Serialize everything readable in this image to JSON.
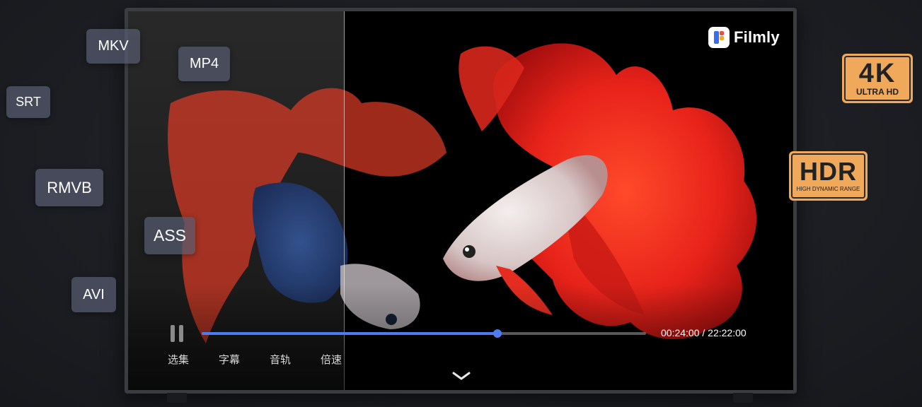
{
  "player": {
    "logo_text": "Filmly",
    "time_display": "00:24:00 / 22:22:00",
    "progress_percent": 66.5,
    "controls": [
      "选集",
      "字幕",
      "音轨",
      "倍速"
    ]
  },
  "format_tags": [
    "MKV",
    "MP4",
    "SRT",
    "RMVB",
    "ASS",
    "AVI"
  ],
  "badges": {
    "uhd": {
      "main": "4K",
      "sub": "ULTRA HD"
    },
    "hdr": {
      "main": "HDR",
      "sub": "HIGH DYNAMIC RANGE"
    }
  },
  "colors": {
    "accent": "#4d7cf2",
    "badge": "#f0a85a",
    "tag_bg": "#585c70"
  }
}
